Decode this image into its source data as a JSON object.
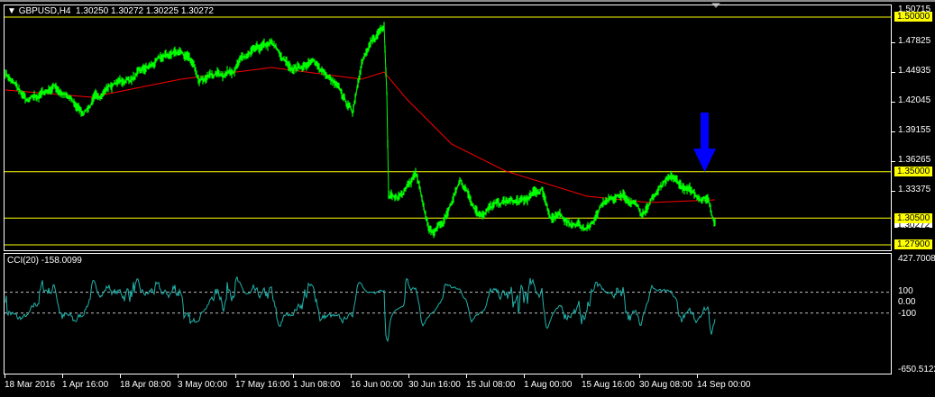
{
  "header": {
    "symbol": "GBPUSD,H4",
    "ohlc": "1.30250 1.30272 1.30225 1.30272"
  },
  "indicator": {
    "label": "CCI(20) -158.0099",
    "max": "427.7008",
    "min": "-650.5122",
    "levels": [
      "100",
      "0.00",
      "-100"
    ]
  },
  "price_scale": [
    "1.50715",
    "1.47825",
    "1.44935",
    "1.42045",
    "1.39155",
    "1.36265",
    "1.33375"
  ],
  "hlines": [
    "1.50000",
    "1.35000",
    "1.30500",
    "1.27900"
  ],
  "current_price": "1.30272",
  "time_labels": [
    "18 Mar 2016",
    "1 Apr 16:00",
    "18 Apr 08:00",
    "3 May 00:00",
    "17 May 16:00",
    "1 Jun 08:00",
    "16 Jun 00:00",
    "30 Jun 16:00",
    "15 Jul 08:00",
    "1 Aug 00:00",
    "15 Aug 16:00",
    "30 Aug 08:00",
    "14 Sep 00:00"
  ],
  "colors": {
    "price": "#00ff00",
    "ma": "#ff0000",
    "cci": "#20b2aa",
    "hline": "#ffff00",
    "arrow": "#0000ff"
  },
  "chart_data": {
    "type": "line",
    "price_range": [
      1.279,
      1.50715
    ],
    "price_series": {
      "bar": [
        0,
        25,
        55,
        85,
        115,
        145,
        175,
        195,
        215,
        245,
        265,
        295,
        315,
        345,
        365,
        385,
        395,
        410,
        420,
        423,
        425,
        435,
        455,
        470,
        485,
        505,
        525,
        555,
        575,
        595,
        605,
        625,
        645,
        665,
        685,
        705,
        725,
        740,
        760,
        780,
        787
      ],
      "close": [
        1.4467,
        1.4162,
        1.4336,
        1.4074,
        1.4336,
        1.4424,
        1.4598,
        1.4686,
        1.4424,
        1.4467,
        1.4598,
        1.4729,
        1.4511,
        1.4555,
        1.4336,
        1.4074,
        1.4598,
        1.4773,
        1.4948,
        1.4293,
        1.3332,
        1.3245,
        1.3463,
        1.2895,
        1.2983,
        1.3419,
        1.3114,
        1.3201,
        1.3201,
        1.3332,
        1.307,
        1.3026,
        1.2939,
        1.3201,
        1.3288,
        1.3114,
        1.3332,
        1.3419,
        1.3288,
        1.3245,
        1.3009
      ]
    },
    "ma_series": {
      "bar": [
        0,
        95,
        195,
        295,
        395,
        420,
        445,
        495,
        555,
        645,
        715,
        787
      ],
      "value": [
        1.4293,
        1.4223,
        1.4398,
        1.4511,
        1.4398,
        1.4467,
        1.4205,
        1.3768,
        1.3506,
        1.3262,
        1.3201,
        1.3227
      ]
    },
    "cci_range": [
      -650.5122,
      427.7008
    ]
  }
}
